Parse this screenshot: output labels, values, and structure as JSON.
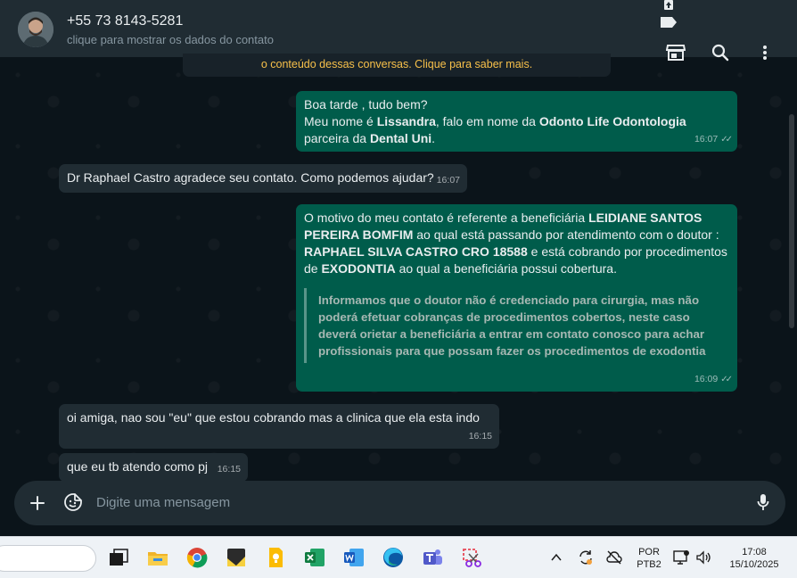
{
  "header": {
    "contact_name": "+55 73 8143-5281",
    "contact_subtitle": "clique para mostrar os dados do contato",
    "icons": [
      "upload-icon",
      "label-icon",
      "store-icon",
      "search-icon",
      "menu-kebab-icon"
    ]
  },
  "banner": {
    "text": "o conteúdo dessas conversas. Clique para saber mais."
  },
  "messages": {
    "m1": {
      "line1": "Boa tarde , tudo bem?",
      "l2a": "Meu nome é ",
      "l2b": "Lissandra",
      "l2c": ", falo em nome da ",
      "l2d": "Odonto Life Odontologia",
      "l3a": "parceira da ",
      "l3b": "Dental Uni",
      "l3c": ".",
      "time": "16:07"
    },
    "m2": {
      "text": "Dr Raphael Castro agradece seu contato. Como podemos ajudar?",
      "time": "16:07"
    },
    "m3": {
      "a": "O motivo do meu contato é referente a beneficiária ",
      "b": "LEIDIANE SANTOS PEREIRA BOMFIM",
      "c": " ao qual está passando por atendimento com o doutor : ",
      "d": "RAPHAEL SILVA CASTRO  CRO 18588",
      "e": " e está cobrando por procedimentos de ",
      "f": "EXODONTIA",
      "g": " ao qual a beneficiária possui cobertura.",
      "quote": "Informamos que o doutor não é credenciado para cirurgia, mas não poderá efetuar cobranças de procedimentos cobertos, neste caso deverá orietar a beneficiária a entrar em contato conosco para achar profissionais para que possam fazer os procedimentos de exodontia",
      "time": "16:09"
    },
    "m4": {
      "text": "oi amiga, nao sou \"eu\" que estou cobrando mas a clinica que ela esta indo",
      "time": "16:15"
    },
    "m5": {
      "text": "que eu tb atendo como pj",
      "time": "16:15"
    }
  },
  "composer": {
    "placeholder": "Digite uma mensagem"
  },
  "taskbar": {
    "language_top": "POR",
    "language_bottom": "PTB2",
    "clock_time": "17:08",
    "clock_date": "15/10/2025",
    "apps": [
      "task-view",
      "file-explorer",
      "chrome",
      "sticky-notes",
      "keep-notes",
      "excel",
      "word",
      "edge",
      "teams",
      "snipping-tool"
    ]
  },
  "colors": {
    "outgoing_bubble": "#005c4b",
    "incoming_bubble": "#202c33",
    "chat_background": "#0b141a",
    "banner_text": "#f7c04a"
  }
}
